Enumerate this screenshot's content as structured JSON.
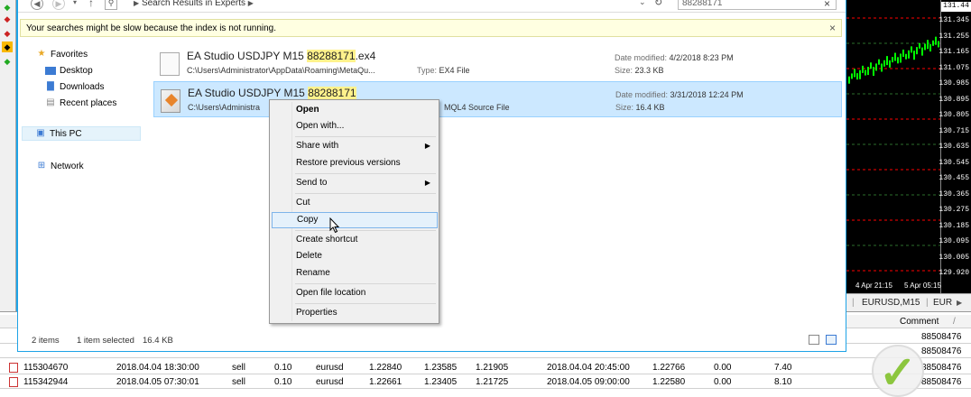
{
  "addressbar": {
    "breadcrumb": "Search Results in Experts",
    "search_value": "88288171",
    "back_icon": "arrow-left-icon",
    "forward_icon": "arrow-right-icon",
    "up_icon": "arrow-up-icon"
  },
  "infobar": {
    "message": "Your searches might be slow because the index is not running.",
    "close": "×"
  },
  "navpane": {
    "favorites": "Favorites",
    "desktop": "Desktop",
    "downloads": "Downloads",
    "recent": "Recent places",
    "this_pc": "This PC",
    "network": "Network"
  },
  "files": [
    {
      "name_prefix": "EA Studio USDJPY M15 ",
      "name_highlight": "88288171",
      "name_suffix": ".ex4",
      "path": "C:\\Users\\Administrator\\AppData\\Roaming\\MetaQu...",
      "type_label": "Type:",
      "type": "EX4 File",
      "date_label": "Date modified:",
      "date": "4/2/2018 8:23 PM",
      "size_label": "Size:",
      "size": "23.3 KB"
    },
    {
      "name_prefix": "EA Studio USDJPY M15 ",
      "name_highlight": "88288171",
      "name_suffix": "",
      "path": "C:\\Users\\Administra",
      "type_label": "",
      "type": "MQL4 Source File",
      "date_label": "Date modified:",
      "date": "3/31/2018 12:24 PM",
      "size_label": "Size:",
      "size": "16.4 KB"
    }
  ],
  "statusbar": {
    "items_count": "2 items",
    "selected": "1 item selected",
    "selected_size": "16.4 KB"
  },
  "context_menu": {
    "open": "Open",
    "open_with": "Open with...",
    "share_with": "Share with",
    "restore": "Restore previous versions",
    "send_to": "Send to",
    "cut": "Cut",
    "copy": "Copy",
    "create_shortcut": "Create shortcut",
    "delete": "Delete",
    "rename": "Rename",
    "open_location": "Open file location",
    "properties": "Properties",
    "submenu_arrow": "▶"
  },
  "chart": {
    "prices": [
      "131.44",
      "131.345",
      "131.255",
      "131.165",
      "131.075",
      "130.985",
      "130.895",
      "130.805",
      "130.715",
      "130.635",
      "130.545",
      "130.455",
      "130.365",
      "130.275",
      "130.185",
      "130.095",
      "130.005",
      "129.920"
    ],
    "x_label_1": "4 Apr 21:15",
    "x_label_2": "5 Apr 05:15",
    "tab_symbol": "EURUSD,M15",
    "tab_more": "EUR"
  },
  "trades": {
    "comment_header": "Comment",
    "rows": [
      {
        "ticket": "",
        "open_time": "",
        "type": "",
        "size": "",
        "symbol": "",
        "open_price": "",
        "sl": "",
        "tp": "",
        "close_time": "",
        "close_price": "",
        "commission": "",
        "profit": "",
        "comment": "88508476"
      },
      {
        "ticket": "",
        "open_time": "",
        "type": "",
        "size": "",
        "symbol": "",
        "open_price": "",
        "sl": "",
        "tp": "",
        "close_time": "",
        "close_price": "",
        "commission": "",
        "profit": "",
        "comment": "88508476"
      },
      {
        "ticket": "115304670",
        "open_time": "2018.04.04 18:30:00",
        "type": "sell",
        "size": "0.10",
        "symbol": "eurusd",
        "open_price": "1.22840",
        "sl": "1.23585",
        "tp": "1.21905",
        "close_time": "2018.04.04 20:45:00",
        "close_price": "1.22766",
        "commission": "0.00",
        "profit": "7.40",
        "comment": "88508476"
      },
      {
        "ticket": "115342944",
        "open_time": "2018.04.05 07:30:01",
        "type": "sell",
        "size": "0.10",
        "symbol": "eurusd",
        "open_price": "1.22661",
        "sl": "1.23405",
        "tp": "1.21725",
        "close_time": "2018.04.05 09:00:00",
        "close_price": "1.22580",
        "commission": "0.00",
        "profit": "8.10",
        "comment": "88508476"
      }
    ]
  },
  "colors": {
    "desktop_blue": "#1ea3e6",
    "selection": "#cce8ff",
    "highlight": "#fff28c",
    "chart_green": "#00ff00",
    "chart_red": "#ff0000",
    "badge_green": "#8cc63e"
  }
}
